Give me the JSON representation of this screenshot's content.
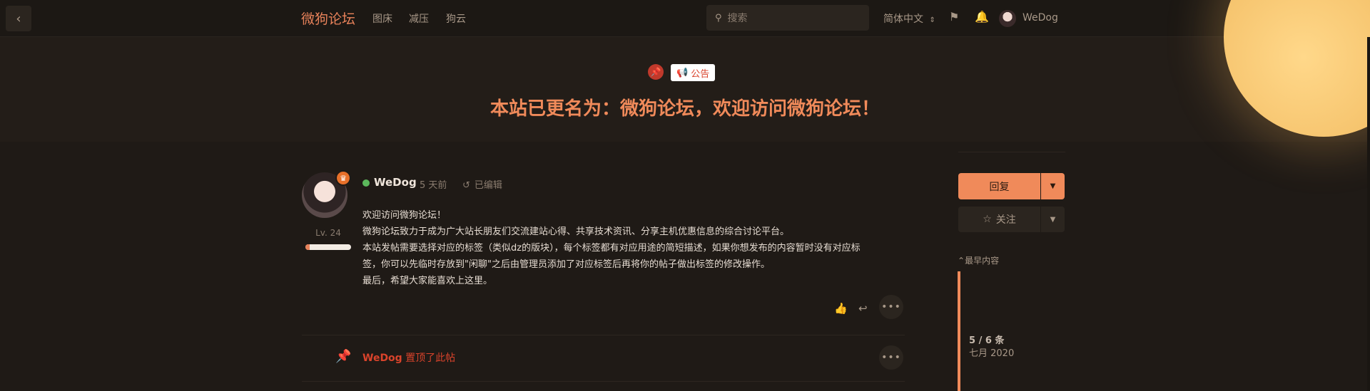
{
  "header": {
    "site_title": "微狗论坛",
    "nav": [
      "图床",
      "减压",
      "狗云"
    ],
    "search_placeholder": "搜索",
    "language": "简体中文",
    "username": "WeDog"
  },
  "discussion": {
    "tag": "公告",
    "title": "本站已更名为：微狗论坛，欢迎访问微狗论坛！"
  },
  "post": {
    "author": "WeDog",
    "level": "Lv. 24",
    "level_progress": 0.1,
    "time": "5 天前",
    "edited": "已编辑",
    "body": [
      "欢迎访问微狗论坛！",
      "微狗论坛致力于成为广大站长朋友们交流建站心得、共享技术资讯、分享主机优惠信息的综合讨论平台。",
      "本站发帖需要选择对应的标签（类似dz的版块），每个标签都有对应用途的简短描述，如果你想发布的内容暂时没有对应标",
      "签，你可以先临时存放到\"闲聊\"之后由管理员添加了对应标签后再将你的帖子做出标签的修改操作。",
      "最后，希望大家能喜欢上这里。"
    ]
  },
  "event": {
    "user": "WeDog",
    "action": "置顶了此帖"
  },
  "sidebar": {
    "reply": "回复",
    "follow": "关注",
    "earliest": "最早内容",
    "count": "5 / 6 条",
    "date": "七月 2020"
  }
}
